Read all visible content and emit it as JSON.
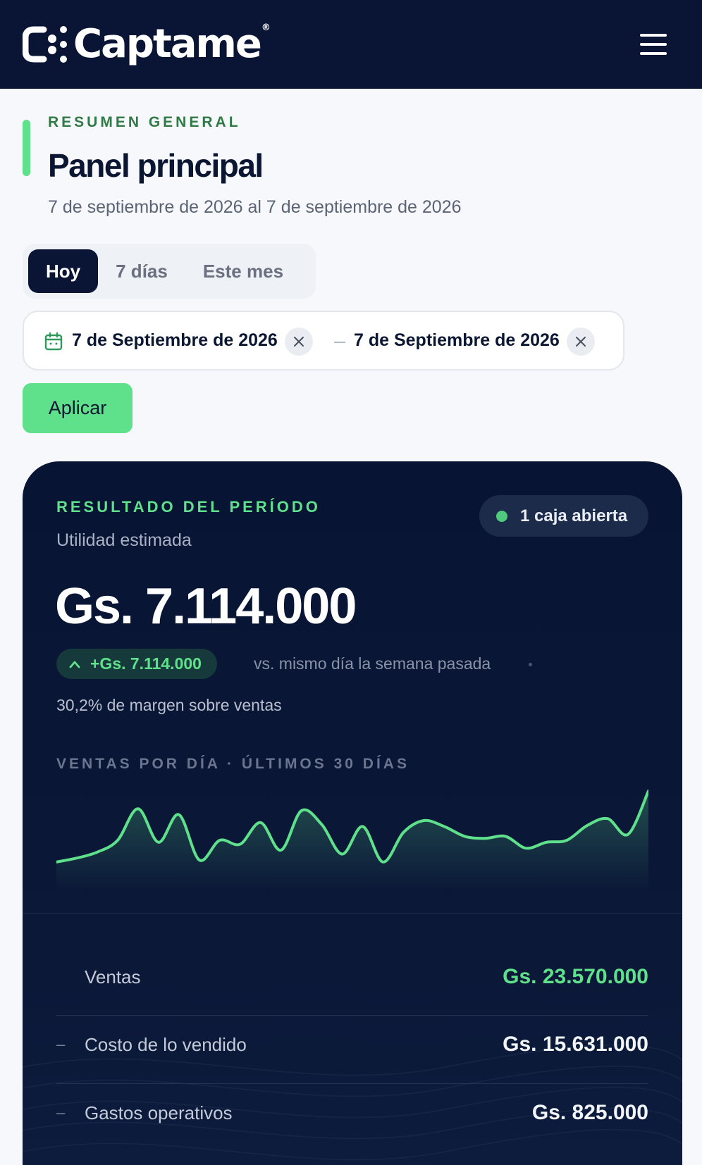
{
  "header": {
    "logo_text": "Captame",
    "logo_mark": "®"
  },
  "page": {
    "eyebrow": "RESUMEN GENERAL",
    "title": "Panel principal",
    "date_range": "7 de septiembre de 2026 al 7 de septiembre de 2026"
  },
  "filters": {
    "tabs": [
      {
        "label": "Hoy",
        "active": true
      },
      {
        "label": "7 días",
        "active": false
      },
      {
        "label": "Este mes",
        "active": false
      }
    ],
    "start_date": "7 de Septiembre de 2026",
    "end_date": "7 de Septiembre de 2026",
    "apply_label": "Aplicar"
  },
  "card": {
    "eyebrow": "RESULTADO DEL PERÍODO",
    "subtitle": "Utilidad estimada",
    "status": "1 caja abierta",
    "value": "Gs. 7.114.000",
    "delta": "+Gs. 7.114.000",
    "compare": "vs. mismo día la semana pasada",
    "margin": "30,2% de margen sobre ventas",
    "chart_title": "VENTAS POR DÍA · ÚLTIMOS 30 DÍAS",
    "rows": [
      {
        "sign": "",
        "label": "Ventas",
        "value": "Gs. 23.570.000",
        "positive": true
      },
      {
        "sign": "–",
        "label": "Costo de lo vendido",
        "value": "Gs. 15.631.000",
        "positive": false
      },
      {
        "sign": "–",
        "label": "Gastos operativos",
        "value": "Gs. 825.000",
        "positive": false
      }
    ]
  },
  "colors": {
    "navy": "#0a1535",
    "accent_green": "#5fe08b",
    "positive_dot": "#4fc97d"
  },
  "chart_data": {
    "type": "area",
    "x": [
      1,
      2,
      3,
      4,
      5,
      6,
      7,
      8,
      9,
      10,
      11,
      12,
      13,
      14,
      15,
      16,
      17,
      18,
      19,
      20,
      21,
      22,
      23,
      24,
      25,
      26,
      27,
      28,
      29,
      30
    ],
    "series": [
      {
        "values": [
          8,
          12,
          18,
          30,
          62,
          28,
          56,
          10,
          30,
          26,
          48,
          20,
          60,
          46,
          16,
          44,
          8,
          38,
          50,
          44,
          34,
          32,
          34,
          22,
          28,
          30,
          45,
          52,
          36,
          80
        ]
      }
    ]
  }
}
